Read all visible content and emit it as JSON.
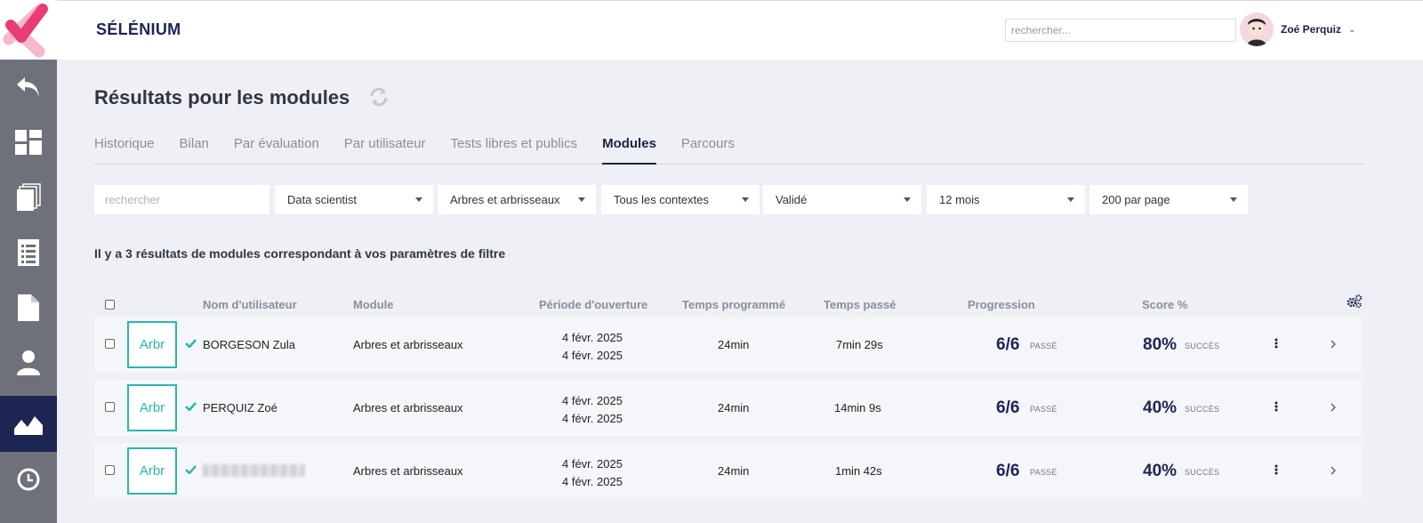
{
  "app": {
    "title": "SÉLÉNIUM"
  },
  "header": {
    "search_placeholder": "rechercher...",
    "user_name": "Zoé Perquiz"
  },
  "colors": {
    "brand": "#1d2552",
    "accent": "#e83e73",
    "teal": "#2bb5b0",
    "sidebar": "#6e7179"
  },
  "sidebar": {
    "items": [
      {
        "icon": "back-arrow-icon"
      },
      {
        "icon": "dashboard-icon"
      },
      {
        "icon": "documents-icon"
      },
      {
        "icon": "list-icon"
      },
      {
        "icon": "page-icon"
      },
      {
        "icon": "user-icon"
      },
      {
        "icon": "results-chart-icon",
        "active": true
      },
      {
        "icon": "clock-icon"
      }
    ]
  },
  "page": {
    "title": "Résultats pour les modules"
  },
  "tabs": [
    {
      "label": "Historique"
    },
    {
      "label": "Bilan"
    },
    {
      "label": "Par évaluation"
    },
    {
      "label": "Par utilisateur"
    },
    {
      "label": "Tests libres et publics"
    },
    {
      "label": "Modules",
      "active": true
    },
    {
      "label": "Parcours"
    }
  ],
  "filters": {
    "search_placeholder": "rechercher",
    "selects": [
      "Data scientist",
      "Arbres et arbrisseaux",
      "Tous les contextes",
      "Validé",
      "12 mois",
      "200 par page"
    ]
  },
  "results_text": "Il y a 3 résultats de modules correspondant à vos paramètres de filtre",
  "table": {
    "headers": {
      "user": "Nom d'utilisateur",
      "module": "Module",
      "period": "Période d'ouverture",
      "planned": "Temps programmé",
      "spent": "Temps passé",
      "progress": "Progression",
      "score": "Score %"
    },
    "rows": [
      {
        "thumb": "Arbr",
        "user": "BORGESON Zula",
        "module": "Arbres et arbrisseaux",
        "start": "4 févr. 2025",
        "end": "4 févr. 2025",
        "planned": "24min",
        "spent": "7min 29s",
        "progress": "6/6",
        "progress_status": "PASSÉ",
        "score": "80%",
        "score_status": "SUCCÈS"
      },
      {
        "thumb": "Arbr",
        "user": "PERQUIZ Zoé",
        "module": "Arbres et arbrisseaux",
        "start": "4 févr. 2025",
        "end": "4 févr. 2025",
        "planned": "24min",
        "spent": "14min 9s",
        "progress": "6/6",
        "progress_status": "PASSÉ",
        "score": "40%",
        "score_status": "SUCCÈS"
      },
      {
        "thumb": "Arbr",
        "user": "",
        "module": "Arbres et arbrisseaux",
        "start": "4 févr. 2025",
        "end": "4 févr. 2025",
        "planned": "24min",
        "spent": "1min 42s",
        "progress": "6/6",
        "progress_status": "PASSÉ",
        "score": "40%",
        "score_status": "SUCCÈS"
      }
    ]
  }
}
